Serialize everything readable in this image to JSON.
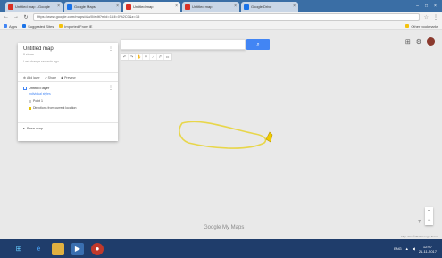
{
  "browser": {
    "tabs": [
      {
        "title": "Untitled map - Google",
        "color": "#d93025",
        "active": false
      },
      {
        "title": "Google Maps",
        "color": "#1a73e8",
        "active": false
      },
      {
        "title": "Untitled map",
        "color": "#d93025",
        "active": true
      },
      {
        "title": "Untitled map",
        "color": "#d93025",
        "active": false
      },
      {
        "title": "Google Drive",
        "color": "#1a73e8",
        "active": false
      }
    ],
    "url": "https://www.google.com/maps/d/u/0/edit?mid=1&ll=0%2C0&z=15",
    "bookmarks": [
      "Apps",
      "Suggested Sites",
      "Imported From IE"
    ],
    "other_bookmarks": "Other bookmarks"
  },
  "map": {
    "search_placeholder": "",
    "panel": {
      "title": "Untitled map",
      "subtitle": "0 views",
      "description": "Last change seconds ago",
      "actions": [
        "Add layer",
        "Share",
        "Preview"
      ],
      "layer_title": "Untitled layer",
      "layer_style": "Individual styles",
      "items": [
        "Point 1",
        "Directions from current location"
      ],
      "basemap": "Base map"
    },
    "logo": "Google My Maps",
    "footer": "Map data ©2017 Google  Terms"
  },
  "taskbar": {
    "time": "12:07",
    "date": "21-11-2017",
    "lang": "ENG"
  }
}
